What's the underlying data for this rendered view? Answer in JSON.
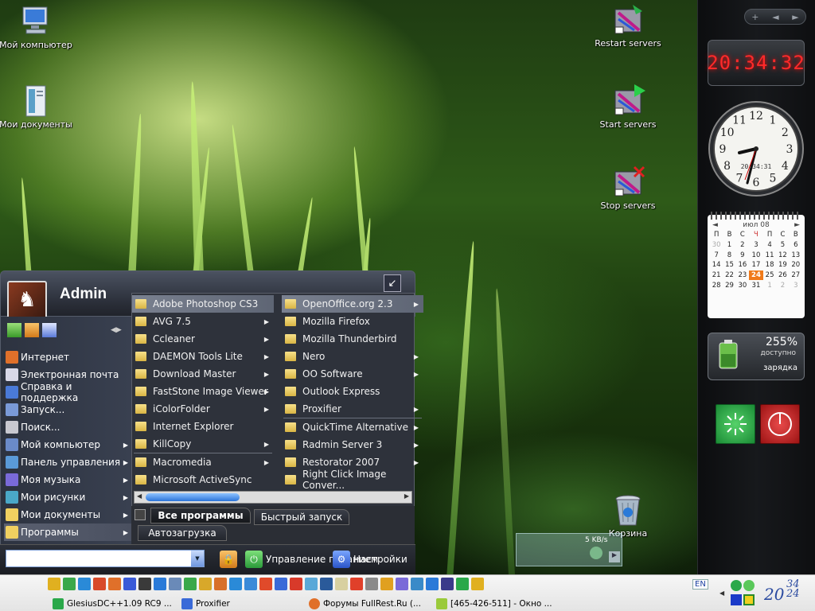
{
  "desktop": {
    "icons": [
      {
        "label": "Мой компьютер"
      },
      {
        "label": "Мои документы"
      },
      {
        "label": "Restart servers"
      },
      {
        "label": "Start servers"
      },
      {
        "label": "Stop servers"
      },
      {
        "label": "Корзина"
      }
    ]
  },
  "sidebar": {
    "controls": [
      "+",
      "◄",
      "►"
    ],
    "digital_clock": "20:34:32",
    "analog_clock": {
      "time_text": "20:34:31",
      "numbers": [
        "12",
        "1",
        "2",
        "3",
        "4",
        "5",
        "6",
        "7",
        "8",
        "9",
        "10",
        "11"
      ]
    },
    "calendar": {
      "month": "июл 08",
      "weekdays": [
        "П",
        "В",
        "С",
        "Ч",
        "П",
        "С",
        "В"
      ],
      "weeks": [
        [
          "30",
          "1",
          "2",
          "3",
          "4",
          "5",
          "6"
        ],
        [
          "7",
          "8",
          "9",
          "10",
          "11",
          "12",
          "13"
        ],
        [
          "14",
          "15",
          "16",
          "17",
          "18",
          "19",
          "20"
        ],
        [
          "21",
          "22",
          "23",
          "24",
          "25",
          "26",
          "27"
        ],
        [
          "28",
          "29",
          "30",
          "31",
          "1",
          "2",
          "3"
        ]
      ],
      "today": "24"
    },
    "battery": {
      "percent": "255%",
      "available": "доступно",
      "status": "зарядка"
    }
  },
  "netwidget": {
    "speed": "5 KB/s"
  },
  "start_menu": {
    "user": "Admin",
    "left_items": [
      {
        "label": "Интернет",
        "arrow": false
      },
      {
        "label": "Электронная почта",
        "arrow": false
      },
      {
        "label": "Справка и поддержка",
        "arrow": false
      },
      {
        "label": "Запуск...",
        "arrow": false
      },
      {
        "label": "Поиск...",
        "arrow": false
      },
      {
        "label": "Мой компьютер",
        "arrow": true
      },
      {
        "label": "Панель управления",
        "arrow": true
      },
      {
        "label": "Моя музыка",
        "arrow": true
      },
      {
        "label": "Мои рисунки",
        "arrow": true
      },
      {
        "label": "Мои документы",
        "arrow": true
      },
      {
        "label": "Программы",
        "arrow": true
      }
    ],
    "programs_col1": [
      {
        "label": "Adobe Photoshop CS3",
        "arrow": false
      },
      {
        "label": "AVG 7.5",
        "arrow": true
      },
      {
        "label": "Ccleaner",
        "arrow": true
      },
      {
        "label": "DAEMON Tools Lite",
        "arrow": true
      },
      {
        "label": "Download Master",
        "arrow": true
      },
      {
        "label": "FastStone Image Viewer",
        "arrow": true
      },
      {
        "label": "iColorFolder",
        "arrow": true
      },
      {
        "label": "Internet Explorer",
        "arrow": false
      },
      {
        "label": "KillCopy",
        "arrow": true
      },
      {
        "label": "Macromedia",
        "arrow": true
      },
      {
        "label": "Microsoft ActiveSync",
        "arrow": false
      }
    ],
    "programs_col2": [
      {
        "label": "OpenOffice.org 2.3",
        "arrow": true
      },
      {
        "label": "Mozilla Firefox",
        "arrow": false
      },
      {
        "label": "Mozilla Thunderbird",
        "arrow": false
      },
      {
        "label": "Nero",
        "arrow": true
      },
      {
        "label": "OO Software",
        "arrow": true
      },
      {
        "label": "Outlook Express",
        "arrow": false
      },
      {
        "label": "Proxifier",
        "arrow": true
      },
      {
        "label": "QuickTime Alternative",
        "arrow": true
      },
      {
        "label": "Radmin Server 3",
        "arrow": true
      },
      {
        "label": "Restorator 2007",
        "arrow": true
      },
      {
        "label": "Right Click Image Conver...",
        "arrow": false
      }
    ],
    "tabs": {
      "all_programs": "Все программы",
      "quick_launch": "Быстрый запуск",
      "autostart": "Автозагрузка"
    },
    "bottom": {
      "search_value": "",
      "manage": "Управление питанием",
      "settings": "Настройки"
    }
  },
  "taskbar": {
    "tasks": [
      "GlesiusDC++1.09 RC9 ...",
      "Proxifier",
      "Форумы FullRest.Ru (...",
      "[465-426-511] - Окно ..."
    ],
    "lang": "EN",
    "clock_hour": "20",
    "clock_min": "34",
    "clock_min2": "24"
  },
  "colors": {
    "accent_red": "#ff2a2a",
    "today_orange": "#f07a1a",
    "menu_bg": "#2e323b"
  }
}
